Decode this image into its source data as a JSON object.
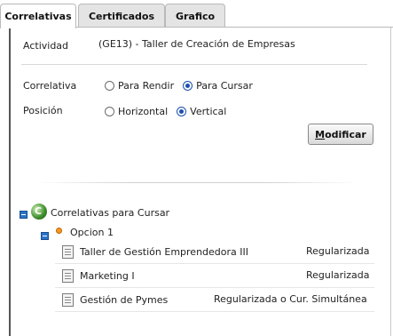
{
  "tabs": [
    {
      "label": "Correlativas"
    },
    {
      "label": "Certificados"
    },
    {
      "label": "Grafico"
    }
  ],
  "form": {
    "actividad_label": "Actividad",
    "actividad_value": "(GE13) - Taller de Creación de Empresas",
    "correlativa_label": "Correlativa",
    "correlativa_options": [
      "Para Rendir",
      "Para Cursar"
    ],
    "correlativa_selected": "Para Cursar",
    "posicion_label": "Posición",
    "posicion_options": [
      "Horizontal",
      "Vertical"
    ],
    "posicion_selected": "Vertical",
    "modificar_mnemonic": "M",
    "modificar_rest": "odificar"
  },
  "tree": {
    "root_label": "Correlativas para Cursar",
    "option_label": "Opcion 1",
    "items": [
      {
        "name": "Taller de Gestión Emprendedora III",
        "status": "Regularizada"
      },
      {
        "name": "Marketing I",
        "status": "Regularizada"
      },
      {
        "name": "Gestión de Pymes",
        "status": "Regularizada o Cur. Simultánea"
      }
    ]
  },
  "colors": {
    "accent": "#1b4fb0",
    "tree_toggle": "#2a74c6",
    "option_dot": "#f39a1c"
  }
}
